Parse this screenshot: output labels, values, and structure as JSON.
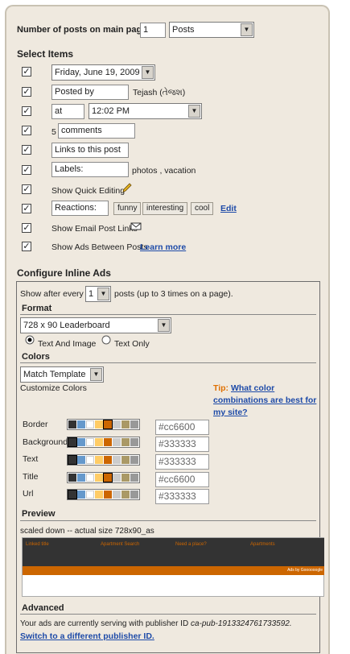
{
  "posts_on_main": {
    "label": "Number of posts on main page:",
    "value": "1",
    "unit": "Posts"
  },
  "select_items": {
    "heading": "Select Items",
    "date_select": "Friday, June 19, 2009",
    "posted_by": {
      "value": "Posted by",
      "author": "Tejash (તેજશ)"
    },
    "time": {
      "prefix": "at",
      "select": "12:02 PM"
    },
    "comments": {
      "count": "5",
      "value": "comments"
    },
    "links": "Links to this post",
    "labels": {
      "value": "Labels:",
      "tags": "photos , vacation"
    },
    "quick_edit": "Show Quick Editing",
    "reactions": {
      "value": "Reactions:",
      "buttons": [
        "funny",
        "interesting",
        "cool"
      ],
      "edit": "Edit"
    },
    "email_links": "Show Email Post Links",
    "ads_between": {
      "label": "Show Ads Between Posts",
      "link": "Learn more"
    }
  },
  "inline_ads": {
    "heading": "Configure Inline Ads",
    "show_after": {
      "prefix": "Show after every",
      "value": "1",
      "suffix": "posts (up to 3 times on a page)."
    },
    "format": {
      "heading": "Format",
      "select": "728 x 90 Leaderboard",
      "opt1": "Text And Image",
      "opt2": "Text Only"
    },
    "colors": {
      "heading": "Colors",
      "select": "Match Template",
      "customize": "Customize Colors",
      "tip_label": "Tip:",
      "tip_link": "What color combinations are best for my site?",
      "rows": [
        {
          "name": "Border",
          "value": "#cc6600"
        },
        {
          "name": "Background",
          "value": "#333333"
        },
        {
          "name": "Text",
          "value": "#333333"
        },
        {
          "name": "Title",
          "value": "#cc6600"
        },
        {
          "name": "Url",
          "value": "#333333"
        }
      ],
      "palette": [
        "#333333",
        "#6699cc",
        "#ffffff",
        "#ffcc66",
        "#cc6600",
        "#cccccc",
        "#aa9966",
        "#999999"
      ]
    },
    "preview": {
      "heading": "Preview",
      "caption": "scaled down -- actual size 728x90_as",
      "ad_links": [
        "Linked title",
        "Apartment Search",
        "Need a place?",
        "Apartments"
      ],
      "ads_by": "Ads by Goooooogle"
    },
    "advanced": {
      "heading": "Advanced",
      "text": "Your ads are currently serving with publisher ID",
      "publisher_id": "ca-pub-1913324761733592.",
      "switch_link": "Switch to a different publisher ID."
    }
  }
}
